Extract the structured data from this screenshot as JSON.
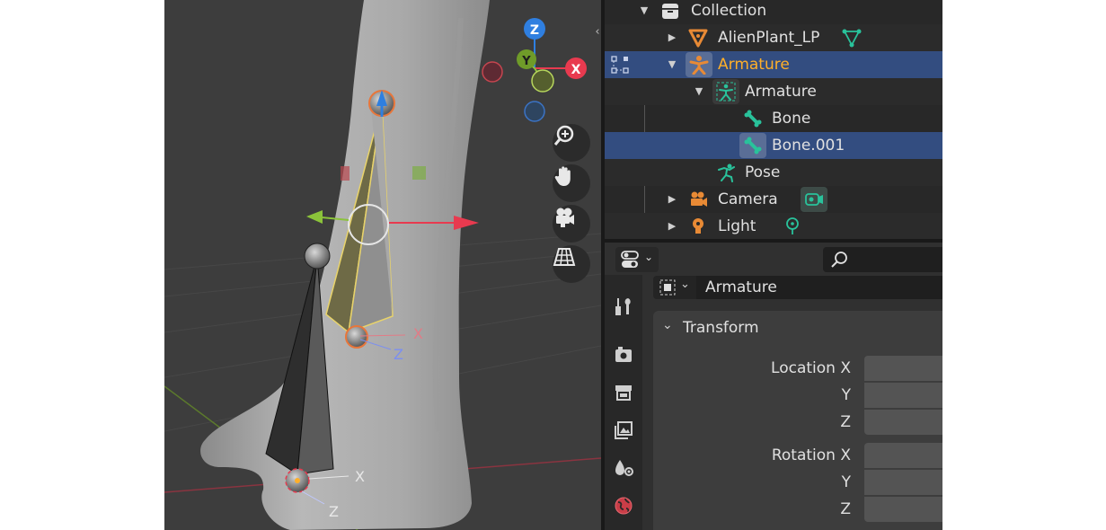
{
  "viewport": {
    "gizmo_axes": {
      "z": "Z",
      "y": "Y",
      "x": "X"
    },
    "bone_axis_labels": {
      "upper_x": "X",
      "upper_z": "Z",
      "lower_x": "X",
      "lower_z": "Z"
    },
    "nav_buttons": [
      "zoom-icon",
      "hand-icon",
      "camera-icon",
      "grid-icon"
    ],
    "colors": {
      "axis_x": "#e83a4f",
      "axis_y": "#8bc33a",
      "axis_z": "#2f7fe0"
    }
  },
  "outliner": {
    "rows": [
      {
        "label": "Collection"
      },
      {
        "label": "AlienPlant_LP"
      },
      {
        "label": "Armature"
      },
      {
        "label": "Armature"
      },
      {
        "label": "Bone"
      },
      {
        "label": "Bone.001"
      },
      {
        "label": "Pose"
      },
      {
        "label": "Camera"
      },
      {
        "label": "Light"
      }
    ],
    "colors": {
      "active_text": "#ffaf29",
      "selected_row": "#334d80",
      "object_orange": "#e88a35",
      "data_green": "#29c29b"
    }
  },
  "properties": {
    "datablock_name": "Armature",
    "panel_title": "Transform",
    "location": {
      "label_x": "Location X",
      "label_y": "Y",
      "label_z": "Z"
    },
    "rotation": {
      "label_x": "Rotation X",
      "label_y": "Y",
      "label_z": "Z"
    }
  }
}
